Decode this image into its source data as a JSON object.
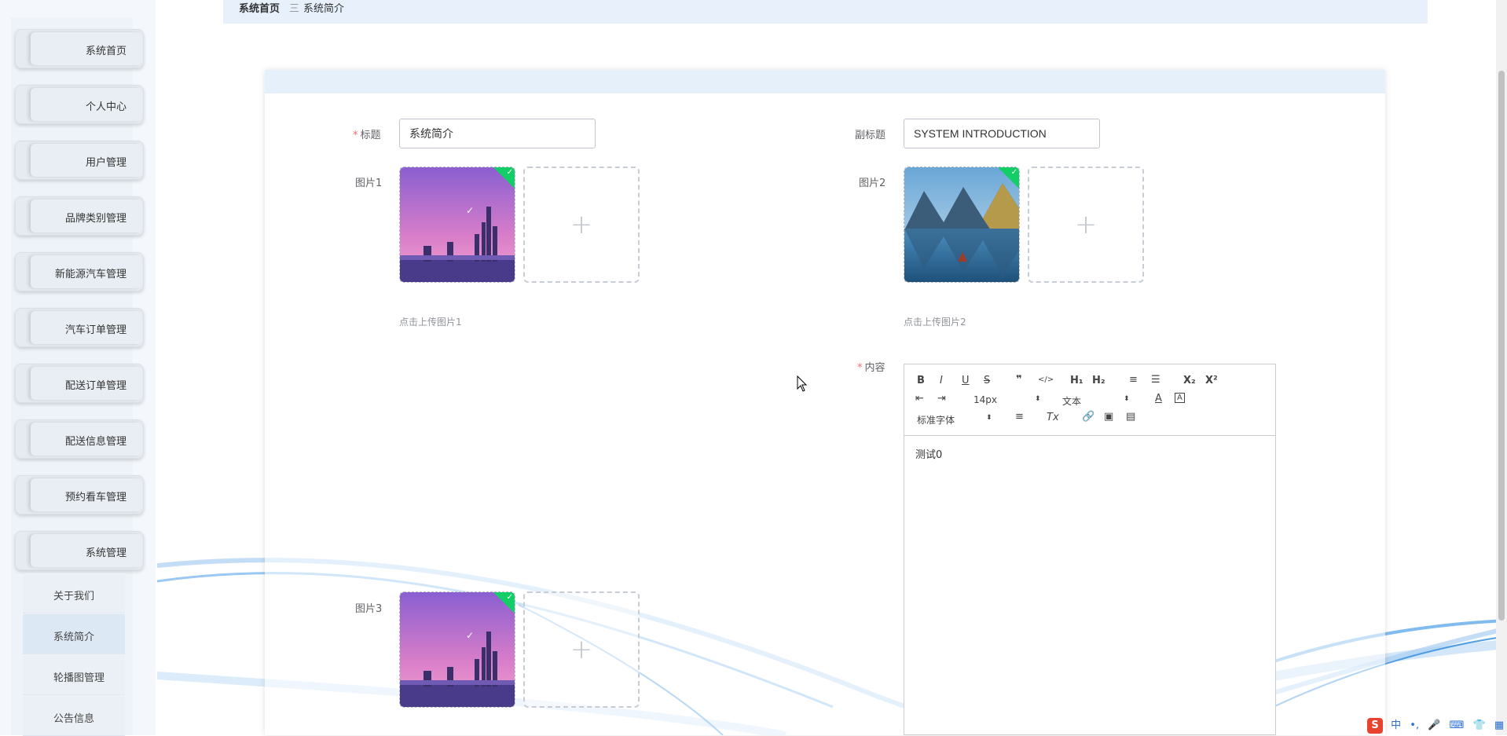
{
  "sidebar": {
    "items": [
      {
        "label": "系统首页"
      },
      {
        "label": "个人中心"
      },
      {
        "label": "用户管理"
      },
      {
        "label": "品牌类别管理"
      },
      {
        "label": "新能源汽车管理"
      },
      {
        "label": "汽车订单管理"
      },
      {
        "label": "配送订单管理"
      },
      {
        "label": "配送信息管理"
      },
      {
        "label": "预约看车管理"
      },
      {
        "label": "系统管理"
      }
    ],
    "submenu": [
      {
        "label": "关于我们"
      },
      {
        "label": "系统简介"
      },
      {
        "label": "轮播图管理"
      },
      {
        "label": "公告信息"
      }
    ]
  },
  "breadcrumb": {
    "home": "系统首页",
    "separator": "三",
    "current": "系统简介"
  },
  "form": {
    "title_label": "标题",
    "title_value": "系统简介",
    "subtitle_label": "副标题",
    "subtitle_value": "SYSTEM INTRODUCTION",
    "image1_label": "图片1",
    "image1_hint": "点击上传图片1",
    "image2_label": "图片2",
    "image2_hint": "点击上传图片2",
    "image3_label": "图片3",
    "content_label": "内容",
    "required_mark": "*",
    "upload_plus": "+"
  },
  "editor": {
    "bold": "B",
    "italic": "I",
    "underline": "U",
    "strike": "S",
    "quote": "❞",
    "code": "</>",
    "h1": "H₁",
    "h2": "H₂",
    "ordered_list": "≡",
    "bullet_list": "☰",
    "subscript": "X₂",
    "superscript": "X²",
    "size_value": "14px",
    "header_value": "文本",
    "font_value": "标准字体",
    "clean": "Tx",
    "content": "测试0"
  },
  "ime": {
    "logo": "S",
    "lang": "中",
    "punct": "•,",
    "mic": "🎤",
    "keyboard": "⌨",
    "skin": "👕",
    "menu": "▦"
  },
  "colors": {
    "accent": "#409eff",
    "required": "#f56c6c",
    "success": "#13ce66",
    "header_bg": "#e6f0fb"
  }
}
